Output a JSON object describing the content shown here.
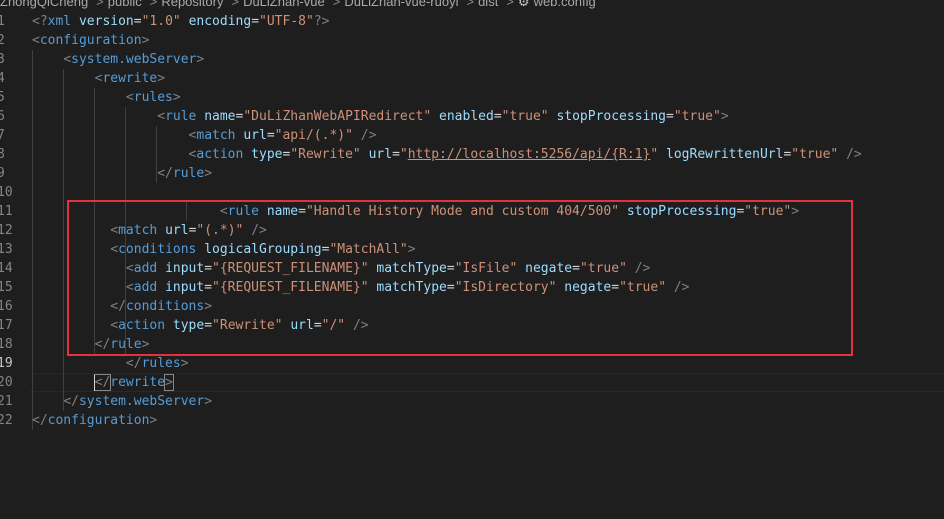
{
  "breadcrumb": {
    "items": [
      "ZhongQiCheng",
      "public",
      "Repository",
      "DuLiZhan-vue",
      "DuLiZhan-vue-ruoyi",
      "dist",
      "web.config"
    ],
    "separator": ">",
    "file_icon": "gear-icon"
  },
  "editor": {
    "line_numbers": [
      "1",
      "2",
      "3",
      "4",
      "5",
      "6",
      "7",
      "8",
      "9",
      "10",
      "11",
      "12",
      "13",
      "14",
      "15",
      "16",
      "17",
      "18",
      "19",
      "20",
      "21",
      "22"
    ],
    "current_line": "19",
    "code_lines": [
      [
        {
          "t": "p",
          "v": "<?"
        },
        {
          "t": "tag",
          "v": "xml"
        },
        {
          "t": "text",
          "v": " "
        },
        {
          "t": "attr",
          "v": "version"
        },
        {
          "t": "eq",
          "v": "="
        },
        {
          "t": "str",
          "v": "\"1.0\""
        },
        {
          "t": "text",
          "v": " "
        },
        {
          "t": "attr",
          "v": "encoding"
        },
        {
          "t": "eq",
          "v": "="
        },
        {
          "t": "str",
          "v": "\"UTF-8\""
        },
        {
          "t": "p",
          "v": "?>"
        }
      ],
      [
        {
          "t": "p",
          "v": "<"
        },
        {
          "t": "tag",
          "v": "configuration"
        },
        {
          "t": "p",
          "v": ">"
        }
      ],
      [
        {
          "t": "text",
          "v": "    "
        },
        {
          "t": "p",
          "v": "<"
        },
        {
          "t": "tag",
          "v": "system.webServer"
        },
        {
          "t": "p",
          "v": ">"
        }
      ],
      [
        {
          "t": "text",
          "v": "        "
        },
        {
          "t": "p",
          "v": "<"
        },
        {
          "t": "tag",
          "v": "rewrite"
        },
        {
          "t": "p",
          "v": ">"
        }
      ],
      [
        {
          "t": "text",
          "v": "            "
        },
        {
          "t": "p",
          "v": "<"
        },
        {
          "t": "tag",
          "v": "rules"
        },
        {
          "t": "p",
          "v": ">"
        }
      ],
      [
        {
          "t": "text",
          "v": "                "
        },
        {
          "t": "p",
          "v": "<"
        },
        {
          "t": "tag",
          "v": "rule"
        },
        {
          "t": "text",
          "v": " "
        },
        {
          "t": "attr",
          "v": "name"
        },
        {
          "t": "eq",
          "v": "="
        },
        {
          "t": "str",
          "v": "\"DuLiZhanWebAPIRedirect\""
        },
        {
          "t": "text",
          "v": " "
        },
        {
          "t": "attr",
          "v": "enabled"
        },
        {
          "t": "eq",
          "v": "="
        },
        {
          "t": "str",
          "v": "\"true\""
        },
        {
          "t": "text",
          "v": " "
        },
        {
          "t": "attr",
          "v": "stopProcessing"
        },
        {
          "t": "eq",
          "v": "="
        },
        {
          "t": "str",
          "v": "\"true\""
        },
        {
          "t": "p",
          "v": ">"
        }
      ],
      [
        {
          "t": "text",
          "v": "                    "
        },
        {
          "t": "p",
          "v": "<"
        },
        {
          "t": "tag",
          "v": "match"
        },
        {
          "t": "text",
          "v": " "
        },
        {
          "t": "attr",
          "v": "url"
        },
        {
          "t": "eq",
          "v": "="
        },
        {
          "t": "str",
          "v": "\"api/(.*)\""
        },
        {
          "t": "text",
          "v": " "
        },
        {
          "t": "p",
          "v": "/>"
        }
      ],
      [
        {
          "t": "text",
          "v": "                    "
        },
        {
          "t": "p",
          "v": "<"
        },
        {
          "t": "tag",
          "v": "action"
        },
        {
          "t": "text",
          "v": " "
        },
        {
          "t": "attr",
          "v": "type"
        },
        {
          "t": "eq",
          "v": "="
        },
        {
          "t": "str",
          "v": "\"Rewrite\""
        },
        {
          "t": "text",
          "v": " "
        },
        {
          "t": "attr",
          "v": "url"
        },
        {
          "t": "eq",
          "v": "="
        },
        {
          "t": "str",
          "v": "\""
        },
        {
          "t": "url",
          "v": "http://localhost:5256/api/{R:1}"
        },
        {
          "t": "str",
          "v": "\""
        },
        {
          "t": "text",
          "v": " "
        },
        {
          "t": "attr",
          "v": "logRewrittenUrl"
        },
        {
          "t": "eq",
          "v": "="
        },
        {
          "t": "str",
          "v": "\"true\""
        },
        {
          "t": "text",
          "v": " "
        },
        {
          "t": "p",
          "v": "/>"
        }
      ],
      [
        {
          "t": "text",
          "v": "                "
        },
        {
          "t": "p",
          "v": "</"
        },
        {
          "t": "tag",
          "v": "rule"
        },
        {
          "t": "p",
          "v": ">"
        }
      ],
      [],
      [
        {
          "t": "text",
          "v": "                        "
        },
        {
          "t": "p",
          "v": "<"
        },
        {
          "t": "tag",
          "v": "rule"
        },
        {
          "t": "text",
          "v": " "
        },
        {
          "t": "attr",
          "v": "name"
        },
        {
          "t": "eq",
          "v": "="
        },
        {
          "t": "str",
          "v": "\"Handle History Mode and custom 404/500\""
        },
        {
          "t": "text",
          "v": " "
        },
        {
          "t": "attr",
          "v": "stopProcessing"
        },
        {
          "t": "eq",
          "v": "="
        },
        {
          "t": "str",
          "v": "\"true\""
        },
        {
          "t": "p",
          "v": ">"
        }
      ],
      [
        {
          "t": "text",
          "v": "          "
        },
        {
          "t": "p",
          "v": "<"
        },
        {
          "t": "tag",
          "v": "match"
        },
        {
          "t": "text",
          "v": " "
        },
        {
          "t": "attr",
          "v": "url"
        },
        {
          "t": "eq",
          "v": "="
        },
        {
          "t": "str",
          "v": "\"(.*)\""
        },
        {
          "t": "text",
          "v": " "
        },
        {
          "t": "p",
          "v": "/>"
        }
      ],
      [
        {
          "t": "text",
          "v": "          "
        },
        {
          "t": "p",
          "v": "<"
        },
        {
          "t": "tag",
          "v": "conditions"
        },
        {
          "t": "text",
          "v": " "
        },
        {
          "t": "attr",
          "v": "logicalGrouping"
        },
        {
          "t": "eq",
          "v": "="
        },
        {
          "t": "str",
          "v": "\"MatchAll\""
        },
        {
          "t": "p",
          "v": ">"
        }
      ],
      [
        {
          "t": "text",
          "v": "            "
        },
        {
          "t": "p",
          "v": "<"
        },
        {
          "t": "tag",
          "v": "add"
        },
        {
          "t": "text",
          "v": " "
        },
        {
          "t": "attr",
          "v": "input"
        },
        {
          "t": "eq",
          "v": "="
        },
        {
          "t": "str",
          "v": "\"{REQUEST_FILENAME}\""
        },
        {
          "t": "text",
          "v": " "
        },
        {
          "t": "attr",
          "v": "matchType"
        },
        {
          "t": "eq",
          "v": "="
        },
        {
          "t": "str",
          "v": "\"IsFile\""
        },
        {
          "t": "text",
          "v": " "
        },
        {
          "t": "attr",
          "v": "negate"
        },
        {
          "t": "eq",
          "v": "="
        },
        {
          "t": "str",
          "v": "\"true\""
        },
        {
          "t": "text",
          "v": " "
        },
        {
          "t": "p",
          "v": "/>"
        }
      ],
      [
        {
          "t": "text",
          "v": "            "
        },
        {
          "t": "p",
          "v": "<"
        },
        {
          "t": "tag",
          "v": "add"
        },
        {
          "t": "text",
          "v": " "
        },
        {
          "t": "attr",
          "v": "input"
        },
        {
          "t": "eq",
          "v": "="
        },
        {
          "t": "str",
          "v": "\"{REQUEST_FILENAME}\""
        },
        {
          "t": "text",
          "v": " "
        },
        {
          "t": "attr",
          "v": "matchType"
        },
        {
          "t": "eq",
          "v": "="
        },
        {
          "t": "str",
          "v": "\"IsDirectory\""
        },
        {
          "t": "text",
          "v": " "
        },
        {
          "t": "attr",
          "v": "negate"
        },
        {
          "t": "eq",
          "v": "="
        },
        {
          "t": "str",
          "v": "\"true\""
        },
        {
          "t": "text",
          "v": " "
        },
        {
          "t": "p",
          "v": "/>"
        }
      ],
      [
        {
          "t": "text",
          "v": "          "
        },
        {
          "t": "p",
          "v": "</"
        },
        {
          "t": "tag",
          "v": "conditions"
        },
        {
          "t": "p",
          "v": ">"
        }
      ],
      [
        {
          "t": "text",
          "v": "          "
        },
        {
          "t": "p",
          "v": "<"
        },
        {
          "t": "tag",
          "v": "action"
        },
        {
          "t": "text",
          "v": " "
        },
        {
          "t": "attr",
          "v": "type"
        },
        {
          "t": "eq",
          "v": "="
        },
        {
          "t": "str",
          "v": "\"Rewrite\""
        },
        {
          "t": "text",
          "v": " "
        },
        {
          "t": "attr",
          "v": "url"
        },
        {
          "t": "eq",
          "v": "="
        },
        {
          "t": "str",
          "v": "\"/\""
        },
        {
          "t": "text",
          "v": " "
        },
        {
          "t": "p",
          "v": "/>"
        }
      ],
      [
        {
          "t": "text",
          "v": "        "
        },
        {
          "t": "p",
          "v": "</"
        },
        {
          "t": "tag",
          "v": "rule"
        },
        {
          "t": "p",
          "v": ">"
        }
      ],
      [
        {
          "t": "text",
          "v": "            "
        },
        {
          "t": "p",
          "v": "</"
        },
        {
          "t": "tag",
          "v": "rules"
        },
        {
          "t": "p",
          "v": ">"
        }
      ],
      [
        {
          "t": "text",
          "v": "        "
        },
        {
          "t": "p",
          "v": "</"
        },
        {
          "t": "tag",
          "v": "rewrite"
        },
        {
          "t": "p",
          "v": ">"
        }
      ],
      [
        {
          "t": "text",
          "v": "    "
        },
        {
          "t": "p",
          "v": "</"
        },
        {
          "t": "tag",
          "v": "system.webServer"
        },
        {
          "t": "p",
          "v": ">"
        }
      ],
      [
        {
          "t": "p",
          "v": "</"
        },
        {
          "t": "tag",
          "v": "configuration"
        },
        {
          "t": "p",
          "v": ">"
        }
      ]
    ]
  },
  "colors": {
    "background": "#1e1e1e",
    "tag": "#569cd6",
    "attribute": "#9cdcfe",
    "string": "#ce9178",
    "punctuation": "#808080",
    "line_number": "#858585",
    "highlight_border": "#e3323b"
  }
}
